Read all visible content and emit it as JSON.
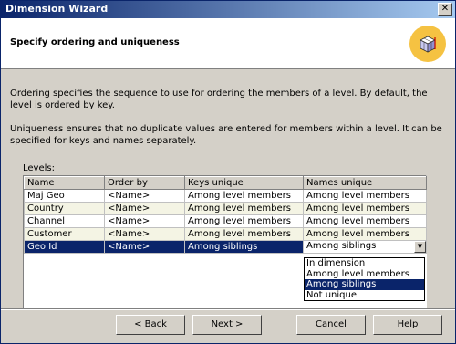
{
  "window": {
    "title": "Dimension Wizard",
    "close_glyph": "✕"
  },
  "header": {
    "title": "Specify ordering and uniqueness",
    "icon": "cube-icon"
  },
  "description": {
    "ordering": "Ordering specifies the sequence to use for ordering the members of a level.  By default, the level is ordered by key.",
    "uniqueness": "Uniqueness ensures that no duplicate values are entered for members within a level.  It can be specified for keys and names separately."
  },
  "levels": {
    "label": "Levels:",
    "columns": [
      "Name",
      "Order by",
      "Keys unique",
      "Names unique"
    ],
    "rows": [
      [
        "Maj Geo",
        "<Name>",
        "Among level members",
        "Among level members"
      ],
      [
        "Country",
        "<Name>",
        "Among level members",
        "Among level members"
      ],
      [
        "Channel",
        "<Name>",
        "Among level members",
        "Among level members"
      ],
      [
        "Customer",
        "<Name>",
        "Among level members",
        "Among level members"
      ],
      [
        "Geo Id",
        "<Name>",
        "Among siblings",
        "Among siblings"
      ]
    ],
    "selected_row": 4
  },
  "dropdown": {
    "options": [
      "In dimension",
      "Among level members",
      "Among siblings",
      "Not unique"
    ],
    "selected": "Among siblings"
  },
  "buttons": {
    "back": "< Back",
    "next": "Next >",
    "cancel": "Cancel",
    "help": "Help"
  },
  "colors": {
    "titlebar": "#0a246a",
    "selection": "#0a246a",
    "icon_bg": "#f5c242"
  }
}
